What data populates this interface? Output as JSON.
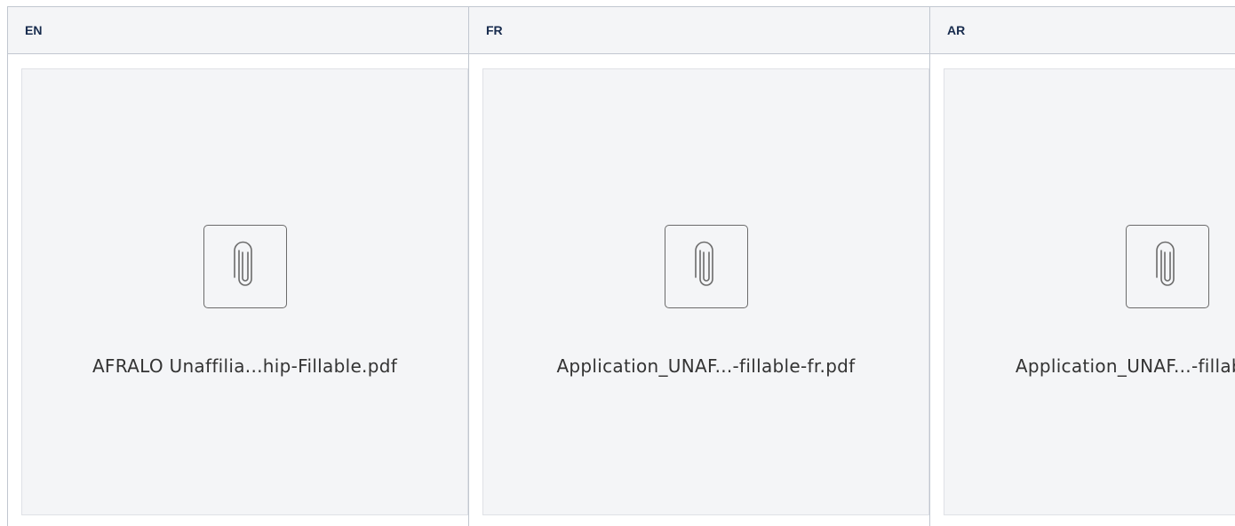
{
  "table": {
    "headers": [
      "EN",
      "FR",
      "AR"
    ],
    "attachments": [
      {
        "filename": "AFRALO Unaffilia...hip-Fillable.pdf",
        "icon": "paperclip-icon"
      },
      {
        "filename": "Application_UNAF...-fillable-fr.pdf",
        "icon": "paperclip-icon"
      },
      {
        "filename": "Application_UNAF...-fillable-ar.pdf",
        "icon": "paperclip-icon"
      }
    ]
  }
}
